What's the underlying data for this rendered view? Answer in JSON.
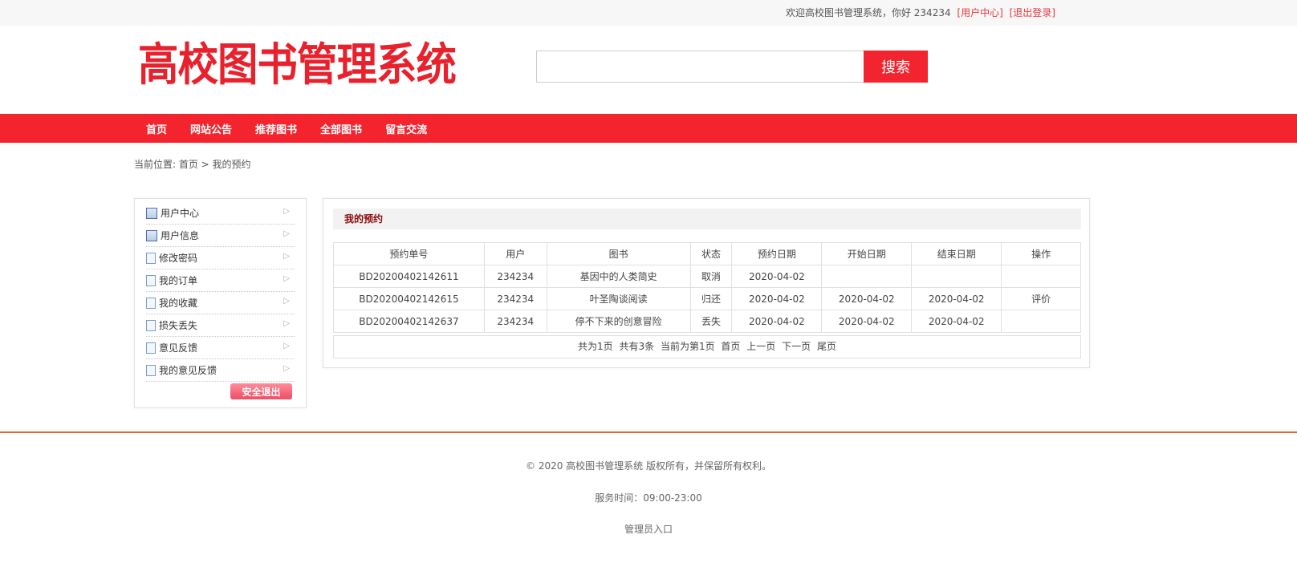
{
  "topbar": {
    "welcome": "欢迎高校图书管理系统，你好 234234",
    "user_center": "[用户中心]",
    "logout": "[退出登录]"
  },
  "header": {
    "logo": "高校图书管理系统",
    "search_placeholder": "",
    "search_button": "搜索"
  },
  "nav": {
    "items": [
      "首页",
      "网站公告",
      "推荐图书",
      "全部图书",
      "留言交流"
    ]
  },
  "breadcrumb": "当前位置: 首页 > 我的预约",
  "sidebar": {
    "items": [
      {
        "label": "用户中心",
        "icon": "user-card-icon"
      },
      {
        "label": "用户信息",
        "icon": "user-card-icon"
      },
      {
        "label": "修改密码",
        "icon": "document-icon"
      },
      {
        "label": "我的订单",
        "icon": "document-icon"
      },
      {
        "label": "我的收藏",
        "icon": "document-icon"
      },
      {
        "label": "损失丢失",
        "icon": "document-icon"
      },
      {
        "label": "意见反馈",
        "icon": "document-icon"
      },
      {
        "label": "我的意见反馈",
        "icon": "document-icon"
      }
    ],
    "logout_button": "安全退出"
  },
  "main": {
    "title": "我的预约",
    "columns": [
      "预约单号",
      "用户",
      "图书",
      "状态",
      "预约日期",
      "开始日期",
      "结束日期",
      "操作"
    ],
    "rows": [
      [
        "BD20200402142611",
        "234234",
        "基因中的人类简史",
        "取消",
        "2020-04-02",
        "",
        "",
        ""
      ],
      [
        "BD20200402142615",
        "234234",
        "叶圣陶谈阅读",
        "归还",
        "2020-04-02",
        "2020-04-02",
        "2020-04-02",
        "评价"
      ],
      [
        "BD20200402142637",
        "234234",
        "停不下来的创意冒险",
        "丢失",
        "2020-04-02",
        "2020-04-02",
        "2020-04-02",
        ""
      ]
    ],
    "pager": {
      "total_pages": "共为1页",
      "total_items": "共有3条",
      "current": "当前为第1页",
      "first": "首页",
      "prev": "上一页",
      "next": "下一页",
      "last": "尾页"
    }
  },
  "footer": {
    "copyright": "© 2020 高校图书管理系统 版权所有，并保留所有权利。",
    "service_hours": "服务时间：09:00-23:00",
    "admin_link": "管理员入口"
  },
  "colors": {
    "brand": "#f4242e",
    "footer_line": "#e8652f",
    "panel_title": "#8b0a0a"
  }
}
